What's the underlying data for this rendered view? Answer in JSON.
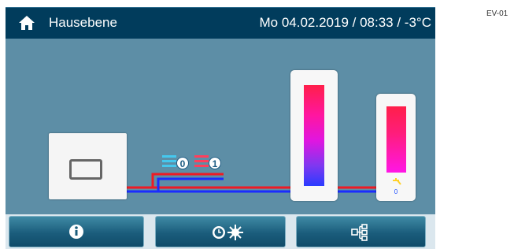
{
  "header": {
    "title": "Hausebene",
    "datetime": "Mo 04.02.2019 / 08:33 / -3°C"
  },
  "device_label": "EV-01",
  "heating_circuits": [
    {
      "value": "0",
      "color": "#45c8ee"
    },
    {
      "value": "1",
      "color": "#ff3f5c"
    }
  ],
  "hot_water": {
    "value": "0"
  },
  "colors": {
    "background": "#5d8ea6",
    "header": "#013c5c",
    "supply_pipe": "#ee1b24",
    "return_pipe": "#1a2cff"
  },
  "footer": {
    "buttons": [
      {
        "icon": "info-icon"
      },
      {
        "icon": "time-program-icon"
      },
      {
        "icon": "system-overview-icon"
      }
    ]
  }
}
